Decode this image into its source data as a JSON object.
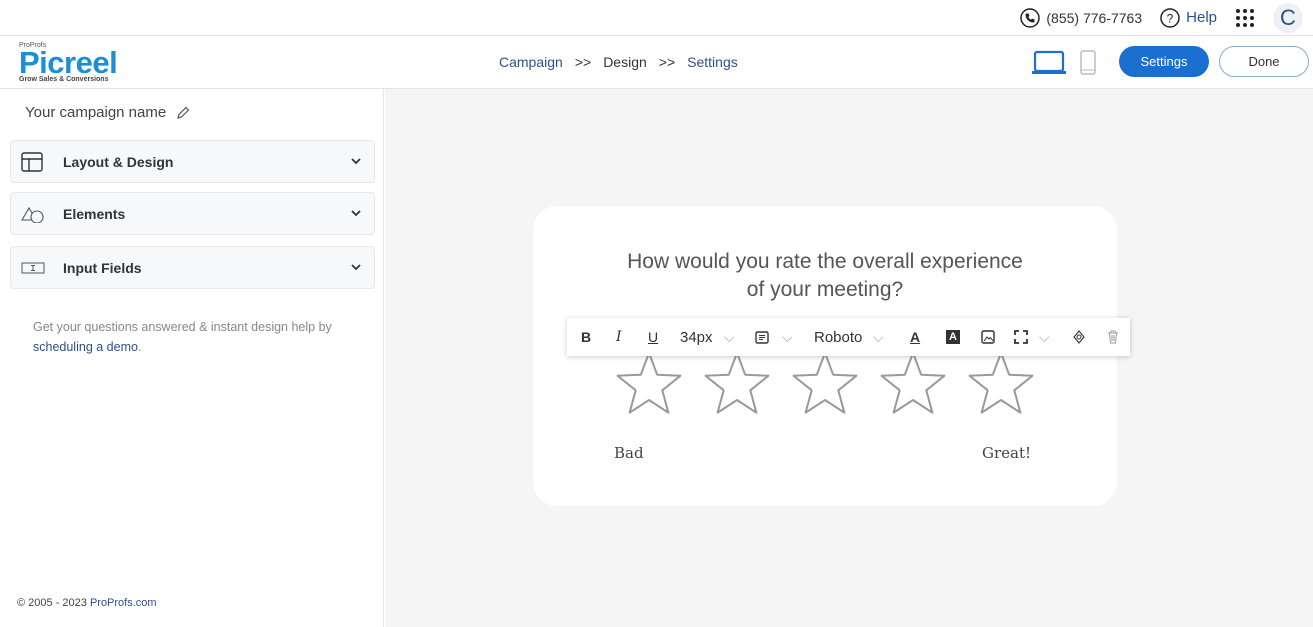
{
  "topbar": {
    "phone": "(855) 776-7763",
    "help": "Help",
    "avatar": "C"
  },
  "logo": {
    "brand": "ProProfs",
    "name": "Picreel",
    "tagline": "Grow Sales & Conversions"
  },
  "steps": {
    "campaign": "Campaign",
    "sep": ">>",
    "design": "Design",
    "settings": "Settings"
  },
  "header": {
    "settings_button": "Settings",
    "done_button": "Done",
    "active_device": "desktop"
  },
  "sidebar": {
    "campaign_name": "Your campaign name",
    "sections": [
      {
        "label": "Layout & Design"
      },
      {
        "label": "Elements"
      },
      {
        "label": "Input Fields"
      }
    ],
    "help_text": "Get your questions answered & instant design help by ",
    "help_link": "scheduling a demo",
    "help_end": ".",
    "copyright": "© 2005 - 2023 ",
    "copyright_link": "ProProfs.com"
  },
  "survey": {
    "question_line1": "How would you rate the overall experience",
    "question_line2": "of your meeting?",
    "stars": 5,
    "low_label": "Bad",
    "high_label": "Great!"
  },
  "toolbar": {
    "bold": "B",
    "italic": "I",
    "underline": "U",
    "font_size": "34px",
    "font": "Roboto",
    "text_color": "A",
    "bg_color": "A"
  },
  "colors": {
    "accent": "#1b6fd1",
    "logo": "#1a8fd8",
    "link": "#2d4f8e"
  }
}
